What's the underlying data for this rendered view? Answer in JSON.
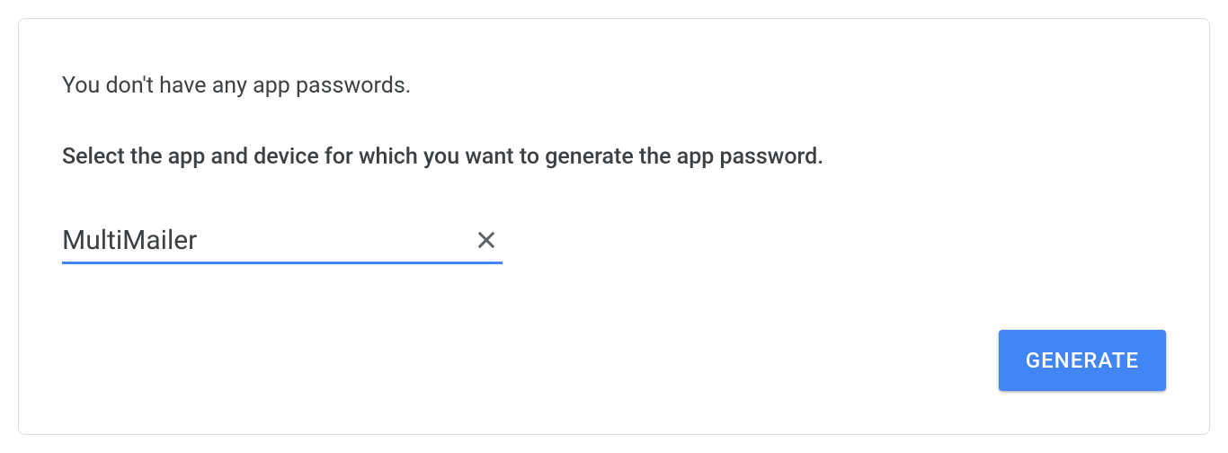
{
  "messages": {
    "empty": "You don't have any app passwords.",
    "instruction": "Select the app and device for which you want to generate the app password."
  },
  "input": {
    "value": "MultiMailer"
  },
  "buttons": {
    "generate": "GENERATE"
  }
}
